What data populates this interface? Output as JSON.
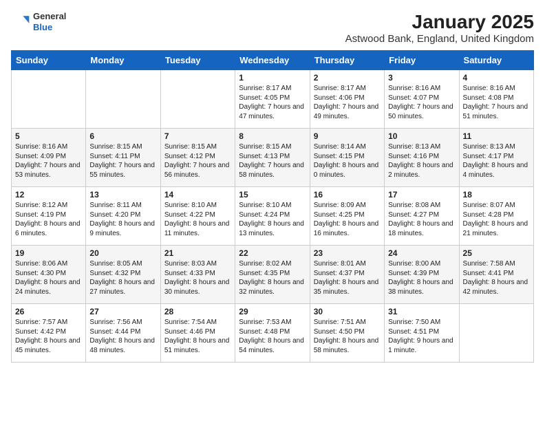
{
  "header": {
    "logo": {
      "general": "General",
      "blue": "Blue"
    },
    "title": "January 2025",
    "subtitle": "Astwood Bank, England, United Kingdom"
  },
  "calendar": {
    "days_of_week": [
      "Sunday",
      "Monday",
      "Tuesday",
      "Wednesday",
      "Thursday",
      "Friday",
      "Saturday"
    ],
    "weeks": [
      [
        {
          "day": "",
          "text": ""
        },
        {
          "day": "",
          "text": ""
        },
        {
          "day": "",
          "text": ""
        },
        {
          "day": "1",
          "text": "Sunrise: 8:17 AM\nSunset: 4:05 PM\nDaylight: 7 hours and 47 minutes."
        },
        {
          "day": "2",
          "text": "Sunrise: 8:17 AM\nSunset: 4:06 PM\nDaylight: 7 hours and 49 minutes."
        },
        {
          "day": "3",
          "text": "Sunrise: 8:16 AM\nSunset: 4:07 PM\nDaylight: 7 hours and 50 minutes."
        },
        {
          "day": "4",
          "text": "Sunrise: 8:16 AM\nSunset: 4:08 PM\nDaylight: 7 hours and 51 minutes."
        }
      ],
      [
        {
          "day": "5",
          "text": "Sunrise: 8:16 AM\nSunset: 4:09 PM\nDaylight: 7 hours and 53 minutes."
        },
        {
          "day": "6",
          "text": "Sunrise: 8:15 AM\nSunset: 4:11 PM\nDaylight: 7 hours and 55 minutes."
        },
        {
          "day": "7",
          "text": "Sunrise: 8:15 AM\nSunset: 4:12 PM\nDaylight: 7 hours and 56 minutes."
        },
        {
          "day": "8",
          "text": "Sunrise: 8:15 AM\nSunset: 4:13 PM\nDaylight: 7 hours and 58 minutes."
        },
        {
          "day": "9",
          "text": "Sunrise: 8:14 AM\nSunset: 4:15 PM\nDaylight: 8 hours and 0 minutes."
        },
        {
          "day": "10",
          "text": "Sunrise: 8:13 AM\nSunset: 4:16 PM\nDaylight: 8 hours and 2 minutes."
        },
        {
          "day": "11",
          "text": "Sunrise: 8:13 AM\nSunset: 4:17 PM\nDaylight: 8 hours and 4 minutes."
        }
      ],
      [
        {
          "day": "12",
          "text": "Sunrise: 8:12 AM\nSunset: 4:19 PM\nDaylight: 8 hours and 6 minutes."
        },
        {
          "day": "13",
          "text": "Sunrise: 8:11 AM\nSunset: 4:20 PM\nDaylight: 8 hours and 9 minutes."
        },
        {
          "day": "14",
          "text": "Sunrise: 8:10 AM\nSunset: 4:22 PM\nDaylight: 8 hours and 11 minutes."
        },
        {
          "day": "15",
          "text": "Sunrise: 8:10 AM\nSunset: 4:24 PM\nDaylight: 8 hours and 13 minutes."
        },
        {
          "day": "16",
          "text": "Sunrise: 8:09 AM\nSunset: 4:25 PM\nDaylight: 8 hours and 16 minutes."
        },
        {
          "day": "17",
          "text": "Sunrise: 8:08 AM\nSunset: 4:27 PM\nDaylight: 8 hours and 18 minutes."
        },
        {
          "day": "18",
          "text": "Sunrise: 8:07 AM\nSunset: 4:28 PM\nDaylight: 8 hours and 21 minutes."
        }
      ],
      [
        {
          "day": "19",
          "text": "Sunrise: 8:06 AM\nSunset: 4:30 PM\nDaylight: 8 hours and 24 minutes."
        },
        {
          "day": "20",
          "text": "Sunrise: 8:05 AM\nSunset: 4:32 PM\nDaylight: 8 hours and 27 minutes."
        },
        {
          "day": "21",
          "text": "Sunrise: 8:03 AM\nSunset: 4:33 PM\nDaylight: 8 hours and 30 minutes."
        },
        {
          "day": "22",
          "text": "Sunrise: 8:02 AM\nSunset: 4:35 PM\nDaylight: 8 hours and 32 minutes."
        },
        {
          "day": "23",
          "text": "Sunrise: 8:01 AM\nSunset: 4:37 PM\nDaylight: 8 hours and 35 minutes."
        },
        {
          "day": "24",
          "text": "Sunrise: 8:00 AM\nSunset: 4:39 PM\nDaylight: 8 hours and 38 minutes."
        },
        {
          "day": "25",
          "text": "Sunrise: 7:58 AM\nSunset: 4:41 PM\nDaylight: 8 hours and 42 minutes."
        }
      ],
      [
        {
          "day": "26",
          "text": "Sunrise: 7:57 AM\nSunset: 4:42 PM\nDaylight: 8 hours and 45 minutes."
        },
        {
          "day": "27",
          "text": "Sunrise: 7:56 AM\nSunset: 4:44 PM\nDaylight: 8 hours and 48 minutes."
        },
        {
          "day": "28",
          "text": "Sunrise: 7:54 AM\nSunset: 4:46 PM\nDaylight: 8 hours and 51 minutes."
        },
        {
          "day": "29",
          "text": "Sunrise: 7:53 AM\nSunset: 4:48 PM\nDaylight: 8 hours and 54 minutes."
        },
        {
          "day": "30",
          "text": "Sunrise: 7:51 AM\nSunset: 4:50 PM\nDaylight: 8 hours and 58 minutes."
        },
        {
          "day": "31",
          "text": "Sunrise: 7:50 AM\nSunset: 4:51 PM\nDaylight: 9 hours and 1 minute."
        },
        {
          "day": "",
          "text": ""
        }
      ]
    ]
  }
}
